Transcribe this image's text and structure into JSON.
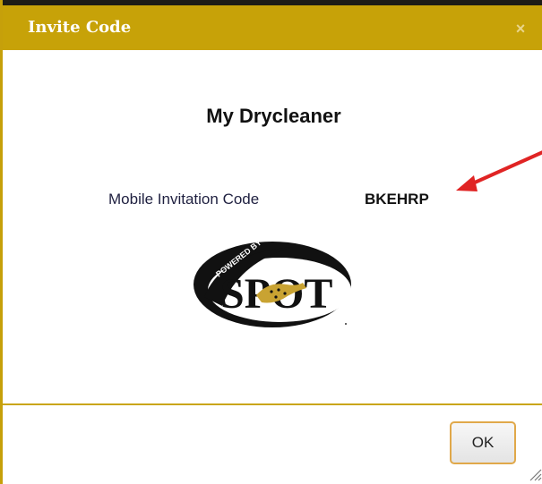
{
  "dialog": {
    "title": "Invite Code",
    "close_icon": "close-icon",
    "store_name": "My Drycleaner",
    "invitation_label": "Mobile Invitation Code",
    "invitation_code": "BKEHRP",
    "logo": {
      "powered_by": "POWERED BY",
      "brand": "SPOT"
    },
    "ok_label": "OK"
  },
  "colors": {
    "titlebar": "#c7a208",
    "arrow": "#e02424",
    "ok_border": "#e0a84a"
  }
}
